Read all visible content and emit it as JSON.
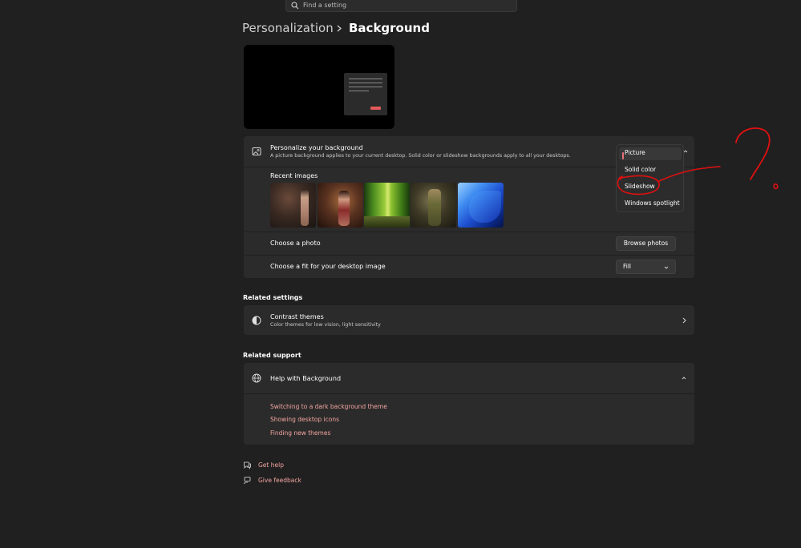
{
  "search": {
    "placeholder": "Find a setting",
    "icon": "search-icon"
  },
  "breadcrumb": {
    "parent": "Personalization",
    "current": "Background"
  },
  "personalize": {
    "title": "Personalize your background",
    "subtitle": "A picture background applies to your current desktop. Solid color or slideshow backgrounds apply to all your desktops.",
    "dropdown": {
      "selected": "Picture",
      "options": [
        "Picture",
        "Solid color",
        "Slideshow",
        "Windows spotlight"
      ]
    }
  },
  "recent": {
    "label": "Recent images"
  },
  "choose_photo": {
    "label": "Choose a photo",
    "button": "Browse photos"
  },
  "choose_fit": {
    "label": "Choose a fit for your desktop image",
    "value": "Fill"
  },
  "related_settings": {
    "heading": "Related settings",
    "contrast": {
      "title": "Contrast themes",
      "subtitle": "Color themes for low vision, light sensitivity"
    }
  },
  "related_support": {
    "heading": "Related support",
    "help_title": "Help with Background",
    "links": [
      "Switching to a dark background theme",
      "Showing desktop icons",
      "Finding new themes"
    ]
  },
  "footer": {
    "get_help": "Get help",
    "give_feedback": "Give feedback"
  },
  "colors": {
    "accent": "#e8707a",
    "link": "#f1a4a0",
    "annotation": "#e01010",
    "background": "#202020",
    "card": "#2b2b2b"
  }
}
